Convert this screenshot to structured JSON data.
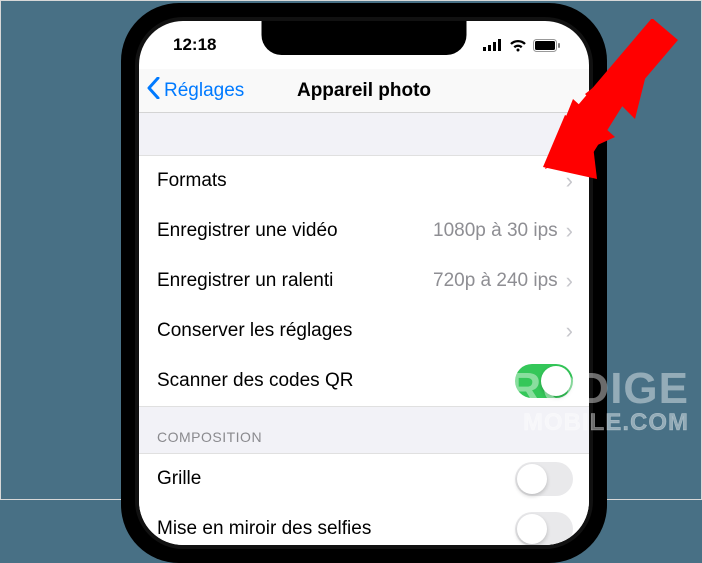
{
  "status": {
    "time": "12:18"
  },
  "nav": {
    "back_label": "Réglages",
    "title": "Appareil photo"
  },
  "rows": {
    "formats": {
      "label": "Formats"
    },
    "record_video": {
      "label": "Enregistrer une vidéo",
      "value": "1080p à 30 ips"
    },
    "record_slomo": {
      "label": "Enregistrer un ralenti",
      "value": "720p à 240 ips"
    },
    "preserve": {
      "label": "Conserver les réglages"
    },
    "scan_qr": {
      "label": "Scanner des codes QR",
      "toggle": true
    },
    "grid": {
      "label": "Grille",
      "toggle": false
    },
    "mirror": {
      "label": "Mise en miroir des selfies",
      "toggle": false
    }
  },
  "section": {
    "composition": "COMPOSITION"
  },
  "watermark": {
    "line1": "PRODIGE",
    "line2": "MOBILE.COM"
  }
}
